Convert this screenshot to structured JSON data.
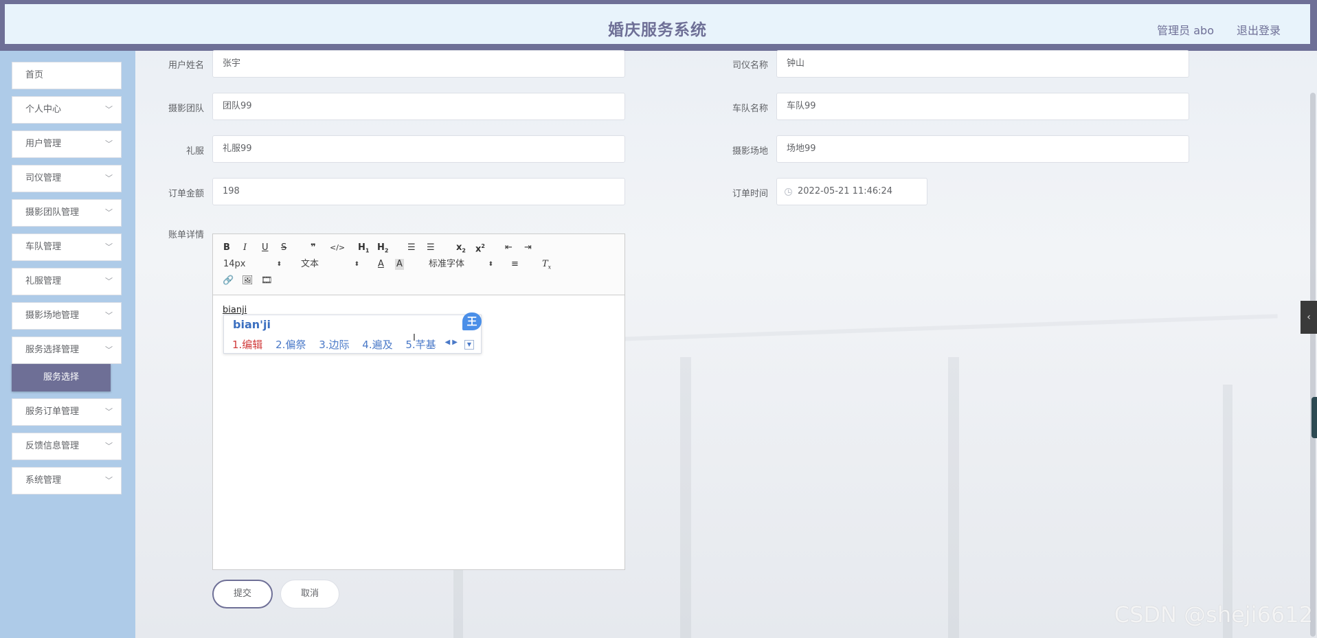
{
  "header": {
    "title": "婚庆服务系统",
    "admin": "管理员 abo",
    "logout": "退出登录"
  },
  "sidebar": {
    "items": [
      {
        "label": "首页",
        "has_arrow": false
      },
      {
        "label": "个人中心",
        "has_arrow": true
      },
      {
        "label": "用户管理",
        "has_arrow": true
      },
      {
        "label": "司仪管理",
        "has_arrow": true
      },
      {
        "label": "摄影团队管理",
        "has_arrow": true
      },
      {
        "label": "车队管理",
        "has_arrow": true
      },
      {
        "label": "礼服管理",
        "has_arrow": true
      },
      {
        "label": "摄影场地管理",
        "has_arrow": true
      },
      {
        "label": "服务选择管理",
        "has_arrow": true
      },
      {
        "label": "服务订单管理",
        "has_arrow": true
      },
      {
        "label": "反馈信息管理",
        "has_arrow": true
      },
      {
        "label": "系统管理",
        "has_arrow": true
      }
    ],
    "active_submenu": "服务选择"
  },
  "form": {
    "username": {
      "label": "用户姓名",
      "value": "张宇"
    },
    "host": {
      "label": "司仪名称",
      "value": "钟山"
    },
    "photo_team": {
      "label": "摄影团队",
      "value": "团队99"
    },
    "fleet": {
      "label": "车队名称",
      "value": "车队99"
    },
    "dress": {
      "label": "礼服",
      "value": "礼服99"
    },
    "venue": {
      "label": "摄影场地",
      "value": "场地99"
    },
    "amount": {
      "label": "订单金额",
      "value": "198"
    },
    "order_time": {
      "label": "订单时间",
      "value": "2022-05-21 11:46:24"
    },
    "details": {
      "label": "账单详情"
    }
  },
  "editor": {
    "font_size": "14px",
    "block_type": "文本",
    "font_family": "标准字体",
    "content": "bianji"
  },
  "ime": {
    "input": "bian'ji",
    "candidates": [
      "1.编辑",
      "2.偏祭",
      "3.边际",
      "4.遍及",
      "5.芊基"
    ],
    "logo": "王"
  },
  "buttons": {
    "submit": "提交",
    "cancel": "取消"
  },
  "watermark": "CSDN @sheji6612",
  "colors": {
    "accent": "#6e6f96",
    "sidebar_bg": "#aecbe8",
    "header_bg": "#e8f3fb"
  }
}
